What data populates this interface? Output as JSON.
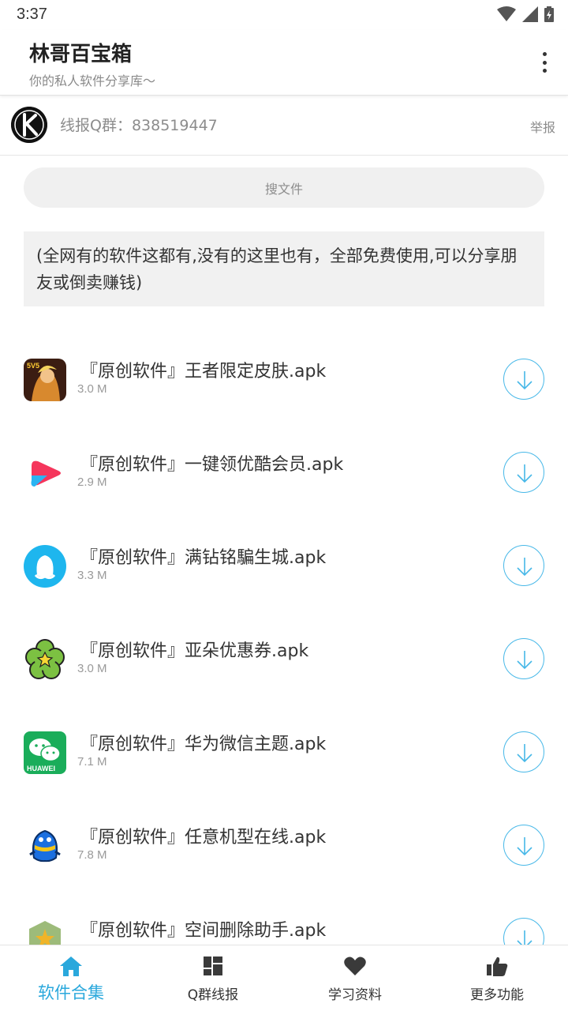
{
  "status_bar": {
    "time": "3:37"
  },
  "header": {
    "title": "林哥百宝箱",
    "subtitle": "你的私人软件分享库～",
    "menu_icon": "overflow-menu-icon"
  },
  "notice": {
    "text": "线报Q群：838519447",
    "report_label": "举报"
  },
  "search": {
    "placeholder": "搜文件"
  },
  "description": "(全网有的软件这都有,没有的这里也有，全部免费使用,可以分享朋友或倒卖赚钱)",
  "colors": {
    "accent": "#2aa8dc",
    "download_ring": "#47b8e8",
    "text": "#333333",
    "muted": "#9a9a9a"
  },
  "apps": [
    {
      "name": "『原创软件』王者限定皮肤.apk",
      "size": "3.0 M",
      "icon": "game-hero-icon"
    },
    {
      "name": "『原创软件』一键领优酷会员.apk",
      "size": "2.9 M",
      "icon": "youku-icon"
    },
    {
      "name": "『原创软件』满钻铭騙生城.apk",
      "size": "3.3 M",
      "icon": "qq-blue-icon"
    },
    {
      "name": "『原创软件』亚朵优惠券.apk",
      "size": "3.0 M",
      "icon": "flower-icon"
    },
    {
      "name": "『原创软件』华为微信主题.apk",
      "size": "7.1 M",
      "icon": "huawei-wechat-icon"
    },
    {
      "name": "『原创软件』任意机型在线.apk",
      "size": "7.8 M",
      "icon": "qq-penguin-icon"
    },
    {
      "name": "『原创软件』空间删除助手.apk",
      "size": "",
      "icon": "space-star-icon"
    }
  ],
  "nav": [
    {
      "label": "软件合集",
      "icon": "home-icon",
      "active": true
    },
    {
      "label": "Q群线报",
      "icon": "dashboard-icon",
      "active": false
    },
    {
      "label": "学习资料",
      "icon": "heart-icon",
      "active": false
    },
    {
      "label": "更多功能",
      "icon": "thumbs-up-icon",
      "active": false
    }
  ]
}
